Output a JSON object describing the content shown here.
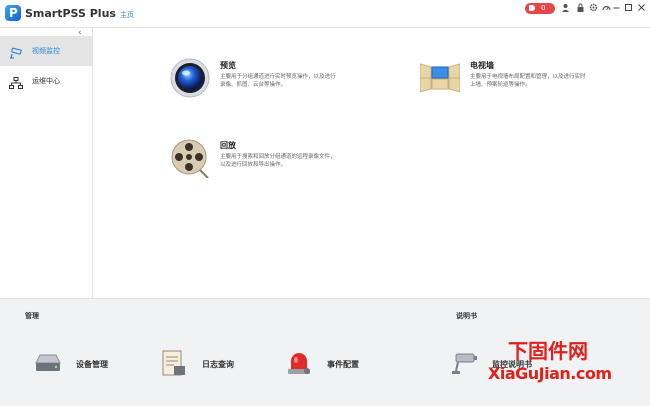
{
  "titlebar": {
    "app_title": "SmartPSS Plus",
    "home_tab": "主页",
    "alarm_count": "0",
    "logo_letter": "P"
  },
  "sidebar": {
    "items": [
      {
        "label": "视频监控",
        "icon": "cctv-camera-icon",
        "active": true
      },
      {
        "label": "运维中心",
        "icon": "network-icon",
        "active": false
      }
    ]
  },
  "main": {
    "modules": [
      {
        "title": "预览",
        "desc": "主要用于分组通道进行实时预览操作，以及进行录像、抓图、云台等操作。",
        "icon": "lens-icon"
      },
      {
        "title": "电视墙",
        "desc": "主要用于电视墙布局配置和管理，以及进行实时上墙、预案轮巡等操作。",
        "icon": "tv-wall-icon"
      },
      {
        "title": "回放",
        "desc": "主要用于搜索和回放分组通道的远程录像文件，以及进行回放和导出操作。",
        "icon": "film-reel-icon"
      }
    ]
  },
  "bottom": {
    "manage_title": "管理",
    "manual_title": "说明书",
    "tools": [
      {
        "label": "设备管理",
        "icon": "device-icon"
      },
      {
        "label": "日志查询",
        "icon": "log-icon"
      },
      {
        "label": "事件配置",
        "icon": "alarm-light-icon"
      },
      {
        "label": "监控说明书",
        "icon": "camera-manual-icon"
      }
    ]
  },
  "watermark": {
    "top": "下固件网",
    "bottom": "XiaGuJian.com"
  },
  "colors": {
    "accent": "#2a86d8",
    "alarm": "#e8474a",
    "watermark": "#e0201a",
    "sidebar_active_bg": "#e4e4e4",
    "bottom_bg": "#f1f2f4"
  }
}
